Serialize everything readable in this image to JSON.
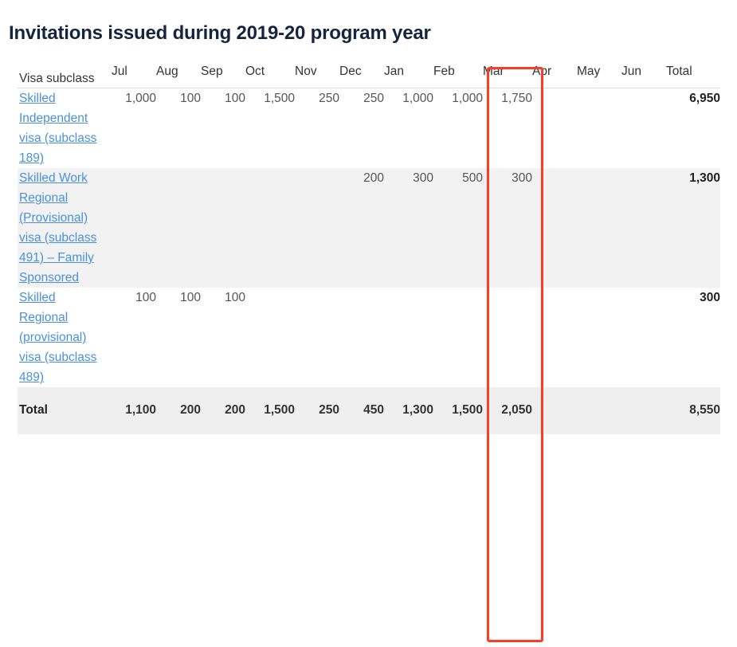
{
  "page": {
    "title": "Invitations issued during 2019-20 program year"
  },
  "table": {
    "columns": [
      "Visa subclass",
      "Jul",
      "Aug",
      "Sep",
      "Oct",
      "Nov",
      "Dec",
      "Jan",
      "Feb",
      "Mar",
      "Apr",
      "May",
      "Jun",
      "Total"
    ],
    "rows": [
      {
        "label": "Skilled Independent visa (subclass 189)",
        "is_link": true,
        "values": [
          "1,000",
          "100",
          "100",
          "1,500",
          "250",
          "250",
          "1,000",
          "1,000",
          "1,750",
          "",
          "",
          ""
        ],
        "total": "6,950"
      },
      {
        "label": "Skilled Work Regional (Provisional) visa (subclass 491) – Family Sponsored",
        "is_link": true,
        "values": [
          "",
          "",
          "",
          "",
          "",
          "200",
          "300",
          "500",
          "300",
          "",
          "",
          ""
        ],
        "total": "1,300"
      },
      {
        "label": "Skilled Regional (provisional) visa (subclass 489)",
        "is_link": true,
        "values": [
          "100",
          "100",
          "100",
          "",
          "",
          "",
          "",
          "",
          "",
          "",
          "",
          ""
        ],
        "total": "300"
      }
    ],
    "totals_row": {
      "label": "Total",
      "values": [
        "1,100",
        "200",
        "200",
        "1,500",
        "250",
        "450",
        "1,300",
        "1,500",
        "2,050",
        "",
        "",
        ""
      ],
      "total": "8,550"
    }
  },
  "annotation": {
    "highlight_column": "Mar",
    "highlight_color": "#fa3c28"
  },
  "colors": {
    "title": "#16253d",
    "link": "#4a90d9",
    "stripe": "#f2f2f2",
    "totals_row": "#efefef",
    "body_text": "#555555"
  }
}
